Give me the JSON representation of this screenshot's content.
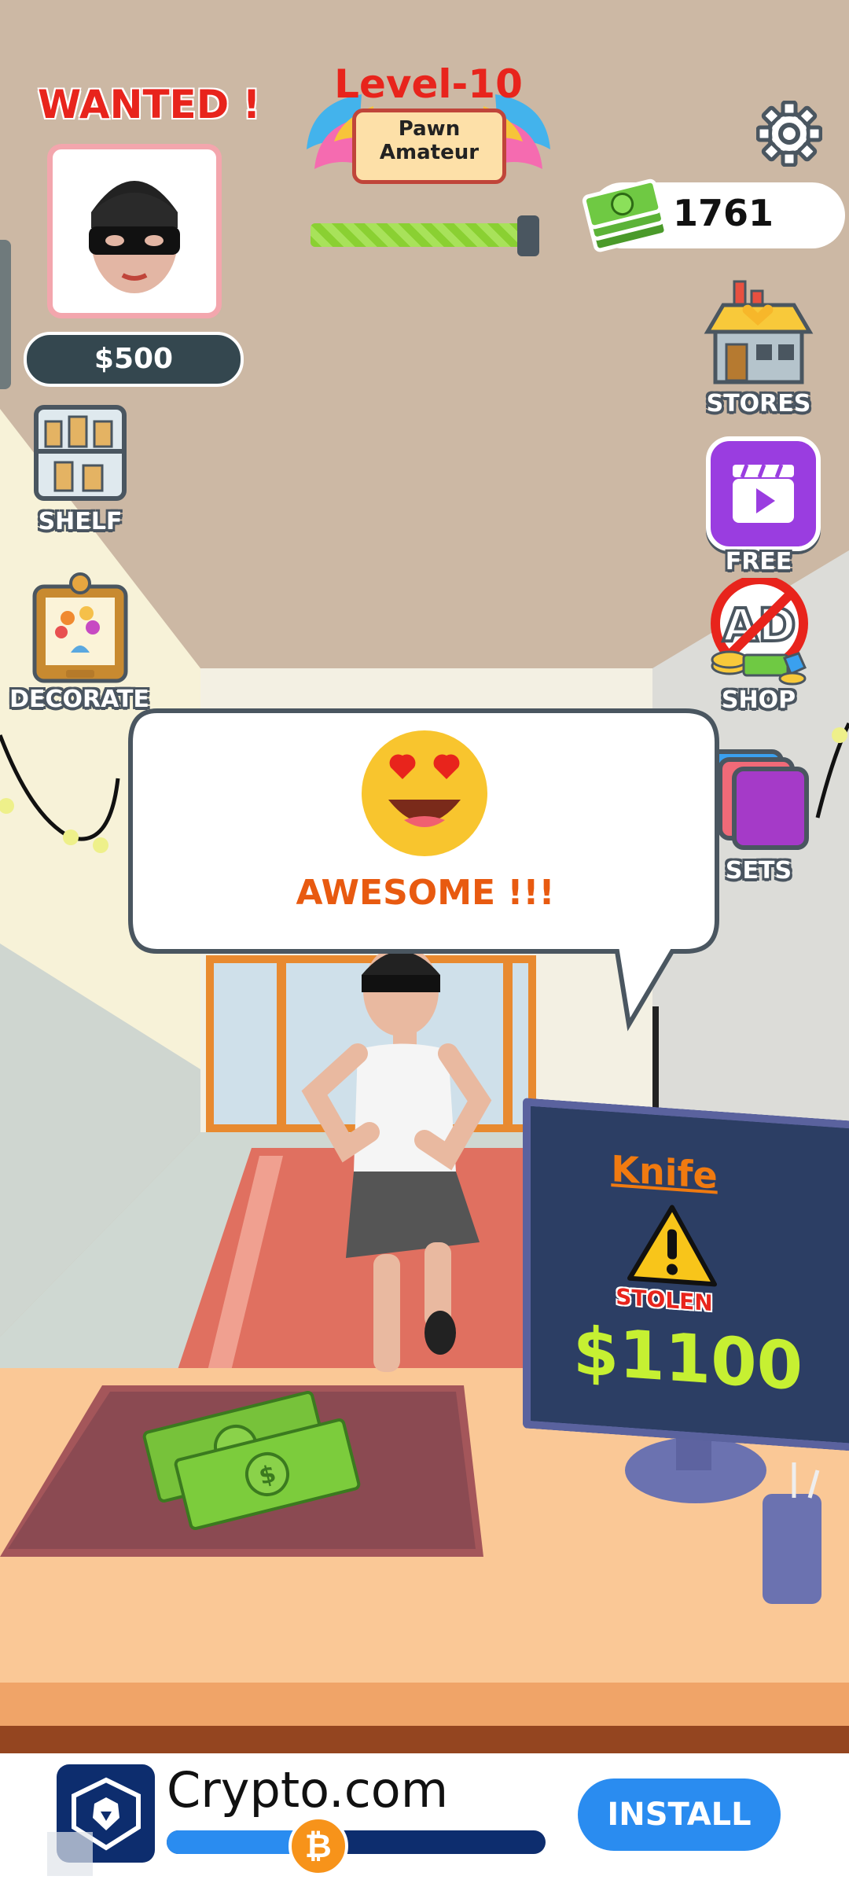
{
  "hud": {
    "wanted_label": "WANTED !",
    "bounty": "$500",
    "level_title": "Level-10",
    "rank_line1": "Pawn",
    "rank_line2": "Amateur",
    "level_progress": 0.97,
    "cash": "1761"
  },
  "left_menu": [
    {
      "label": "SHELF",
      "icon": "shelf-icon"
    },
    {
      "label": "DECORATE",
      "icon": "picture-frame-icon"
    }
  ],
  "right_menu": [
    {
      "label": "STORES",
      "icon": "store-icon"
    },
    {
      "label": "FREE",
      "icon": "video-icon"
    },
    {
      "label": "SHOP",
      "icon": "no-ads-icon"
    },
    {
      "label": "SETS",
      "icon": "cards-icon"
    }
  ],
  "speech": {
    "emoji": "heart-eyes-emoji",
    "message": "AWESOME !!!"
  },
  "monitor": {
    "item": "Knife",
    "status": "STOLEN",
    "price": "$1100"
  },
  "ad": {
    "brand": "Crypto.com",
    "cta": "INSTALL",
    "progress": 0.4
  },
  "colors": {
    "accent_red": "#e8241c",
    "status_orange": "#e85a10",
    "price_green": "#c6f032",
    "ad_button": "#2a8cf0"
  }
}
